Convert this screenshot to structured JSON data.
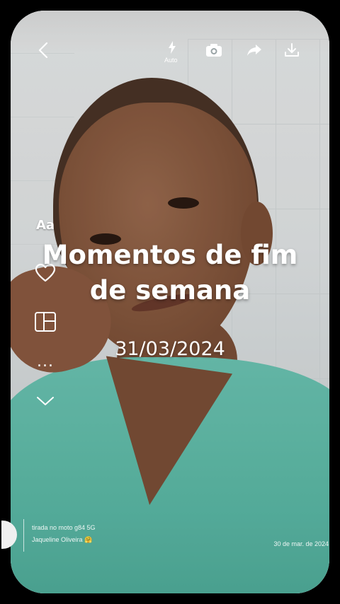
{
  "app": {
    "accent": "#ffffff",
    "scrubs_color": "#5bb9a6"
  },
  "topbar": {
    "back_icon": "chevron-left-icon",
    "flash_icon": "flash-icon",
    "flash_label": "Auto",
    "camera_icon": "camera-icon",
    "share_icon": "share-icon",
    "download_icon": "download-icon"
  },
  "side_tools": {
    "text_tool_label": "Aa",
    "favorite_icon": "heart-icon",
    "layout_icon": "layout-grid-icon",
    "more_label": "...",
    "expand_icon": "chevron-down-icon"
  },
  "overlay": {
    "title": "Momentos de fim de semana",
    "date": "31/03/2024"
  },
  "photo_info": {
    "device": "tirada no moto g84 5G",
    "author": "Jaqueline Oliveira 🤗",
    "date": "30 de mar. de 2024"
  }
}
